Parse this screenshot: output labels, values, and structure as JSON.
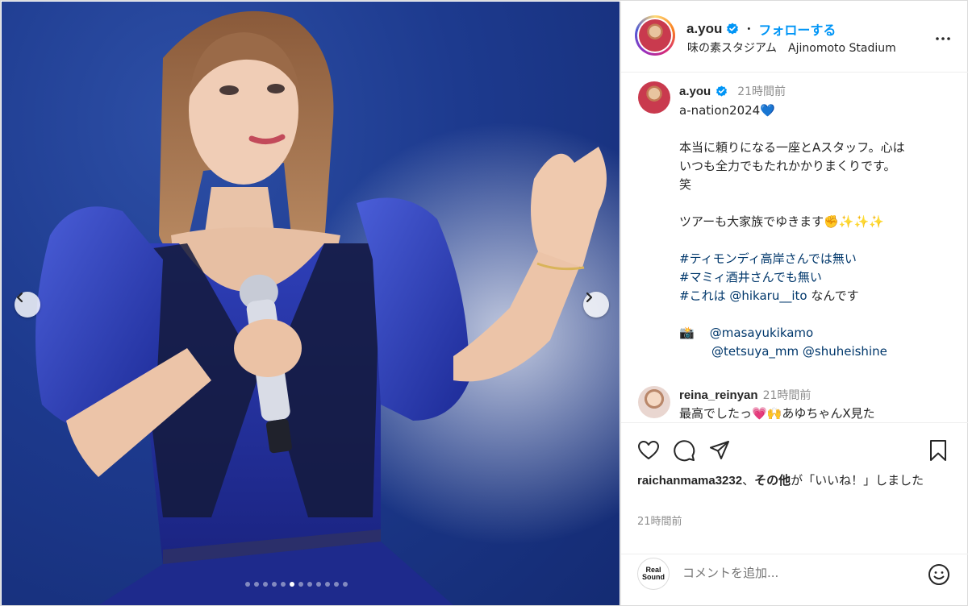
{
  "post": {
    "username": "a.you",
    "follow_label": "フォローする",
    "separator": "・",
    "location": "味の素スタジアム　Ajinomoto Stadium",
    "caption": {
      "username": "a.you",
      "time": "21時間前",
      "line1": "a-nation2024💙",
      "line2": "本当に頼りになる一座とAスタッフ。心は",
      "line3": "いつも全力でもたれかかりまくりです。",
      "line4": "笑",
      "line5": "ツアーも大家族でゆきます✊✨✨✨",
      "hashtag1": "#ティモンディ高岸さんでは無い",
      "hashtag2": "#マミィ酒井さんでも無い",
      "hashtag3_prefix": "#これは",
      "hashtag3_mention": "@hikaru__ito",
      "hashtag3_suffix": " なんです",
      "camera_emoji": "📸",
      "credit1": "@masayukikamo",
      "credit2a": "@tetsuya_mm",
      "credit2b": "@shuheishine"
    },
    "comment": {
      "username": "reina_reinyan",
      "time": "21時間前",
      "text": "最高でしたっ💗🙌あゆちゃんX見た"
    },
    "likes": {
      "user": "raichanmama3232",
      "mid": "、",
      "others": "その他",
      "rest": "が「いいね！」しました"
    },
    "post_time": "21時間前",
    "comment_placeholder": "コメントを追加...",
    "viewer_logo": [
      "Real",
      "Sound"
    ],
    "carousel": {
      "total": 12,
      "active_index": 5
    }
  },
  "icons": [
    "verified-badge-icon",
    "more-options-icon",
    "heart-icon",
    "comment-icon",
    "share-icon",
    "bookmark-icon",
    "emoji-icon",
    "chevron-left-icon",
    "chevron-right-icon"
  ],
  "colors": {
    "accent": "#0095f6",
    "link": "#00376b",
    "muted": "#8e8e8e",
    "text": "#262626",
    "stage_blue": "#1d3a8e"
  }
}
